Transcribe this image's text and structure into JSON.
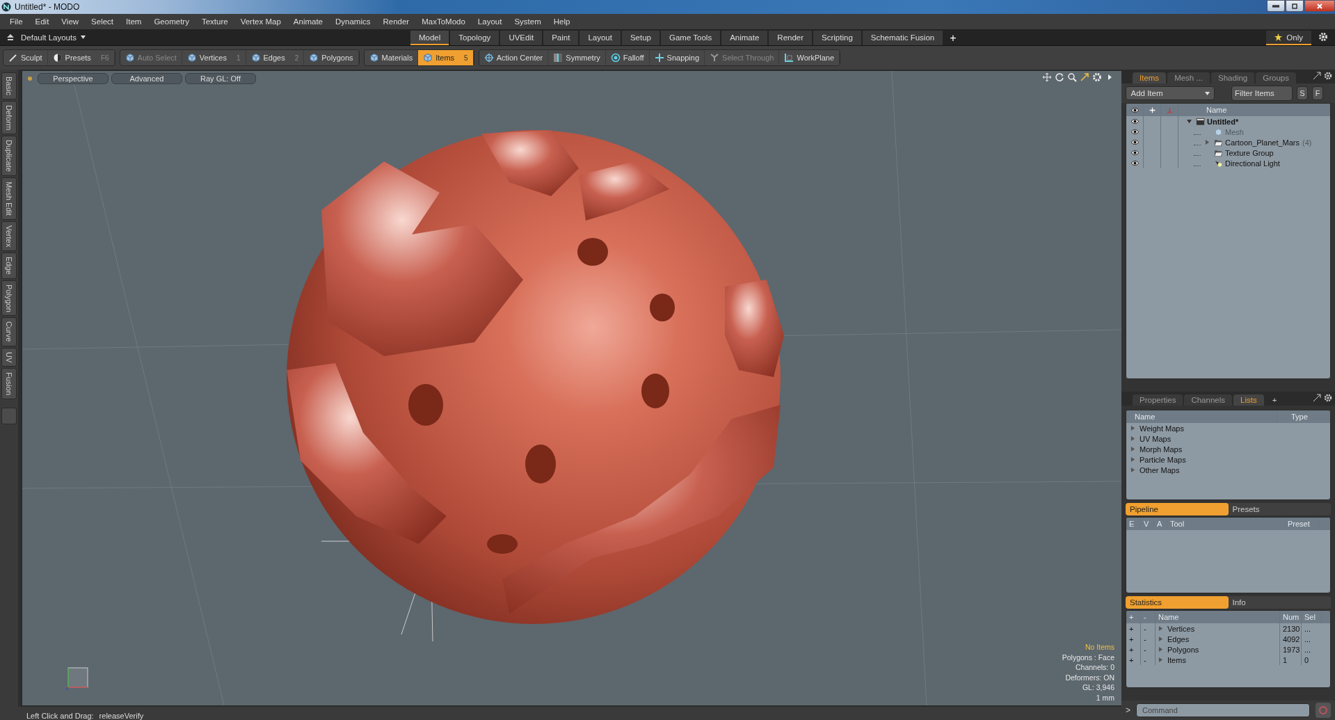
{
  "title_bar": {
    "title": "Untitled* - MODO"
  },
  "menu": [
    "File",
    "Edit",
    "View",
    "Select",
    "Item",
    "Geometry",
    "Texture",
    "Vertex Map",
    "Animate",
    "Dynamics",
    "Render",
    "MaxToModo",
    "Layout",
    "System",
    "Help"
  ],
  "layout_bar": {
    "layouts_menu": "Default Layouts",
    "tabs": [
      {
        "label": "Model",
        "selected": true
      },
      {
        "label": "Topology",
        "selected": false
      },
      {
        "label": "UVEdit",
        "selected": false
      },
      {
        "label": "Paint",
        "selected": false
      },
      {
        "label": "Layout",
        "selected": false
      },
      {
        "label": "Setup",
        "selected": false
      },
      {
        "label": "Game Tools",
        "selected": false
      },
      {
        "label": "Animate",
        "selected": false
      },
      {
        "label": "Render",
        "selected": false
      },
      {
        "label": "Scripting",
        "selected": false
      },
      {
        "label": "Schematic Fusion",
        "selected": false
      }
    ],
    "add_tab": "+",
    "only": "Only"
  },
  "toolbar": {
    "groups": [
      {
        "items": [
          {
            "label": "Sculpt",
            "selected": false,
            "disabled": false
          },
          {
            "label": "Presets",
            "shortcut": "F6",
            "selected": false,
            "disabled": false
          }
        ]
      },
      {
        "items": [
          {
            "label": "Auto Select",
            "selected": false,
            "disabled": true
          },
          {
            "label": "Vertices",
            "shortcut": "1",
            "selected": false,
            "disabled": false
          },
          {
            "label": "Edges",
            "shortcut": "2",
            "selected": false,
            "disabled": false
          },
          {
            "label": "Polygons",
            "selected": false,
            "disabled": false
          }
        ]
      },
      {
        "items": [
          {
            "label": "Materials",
            "selected": false,
            "disabled": false
          },
          {
            "label": "Items",
            "shortcut": "5",
            "selected": true,
            "disabled": false
          }
        ]
      },
      {
        "items": [
          {
            "label": "Action Center",
            "selected": false,
            "disabled": false
          },
          {
            "label": "Symmetry",
            "selected": false,
            "disabled": false
          },
          {
            "label": "Falloff",
            "selected": false,
            "disabled": false
          },
          {
            "label": "Snapping",
            "selected": false,
            "disabled": false
          },
          {
            "label": "Select Through",
            "selected": false,
            "disabled": true
          },
          {
            "label": "WorkPlane",
            "selected": false,
            "disabled": false
          }
        ]
      }
    ]
  },
  "side_tabs": [
    "Basic",
    "Deform",
    "Duplicate",
    "Mesh Edit",
    "Vertex",
    "Edge",
    "Polygon",
    "Curve",
    "UV",
    "Fusion"
  ],
  "viewport": {
    "buttons": [
      "Perspective",
      "Advanced",
      "Ray GL: Off"
    ],
    "status": "No Items",
    "info": [
      "Polygons : Face",
      "Channels: 0",
      "Deformers: ON",
      "GL: 3,946",
      "1 mm"
    ]
  },
  "status_bar": {
    "hint": "Left Click and Drag:",
    "command": "releaseVerify"
  },
  "items_panel": {
    "tabs": [
      {
        "label": "Items",
        "selected": true
      },
      {
        "label": "Mesh ...",
        "selected": false
      },
      {
        "label": "Shading",
        "selected": false
      },
      {
        "label": "Groups",
        "selected": false
      }
    ],
    "add_item": "Add Item",
    "filter": {
      "placeholder": "Filter Items"
    },
    "s_button": "S",
    "f_button": "F",
    "name_column": "Name",
    "tree": [
      {
        "label": "Untitled*",
        "kind": "scene",
        "expanded": true,
        "children": [
          {
            "label": "Mesh",
            "kind": "mesh",
            "disabled": true
          },
          {
            "label": "Cartoon_Planet_Mars",
            "count": "(4)",
            "kind": "group",
            "expanded": false
          },
          {
            "label": "Texture Group",
            "kind": "group"
          },
          {
            "label": "Directional Light",
            "kind": "light"
          }
        ]
      }
    ]
  },
  "lists_panel": {
    "tabs": [
      {
        "label": "Properties",
        "selected": false
      },
      {
        "label": "Channels",
        "selected": false
      },
      {
        "label": "Lists",
        "selected": true
      }
    ],
    "add_tab": "+",
    "columns": [
      "Name",
      "Type"
    ],
    "rows": [
      {
        "name": "Weight Maps",
        "expanded": false
      },
      {
        "name": "UV Maps",
        "expanded": false
      },
      {
        "name": "Morph Maps",
        "expanded": false
      },
      {
        "name": "Particle Maps",
        "expanded": false
      },
      {
        "name": "Other Maps",
        "expanded": false
      }
    ]
  },
  "pipeline_panel": {
    "tabs": [
      {
        "label": "Pipeline",
        "selected": true
      },
      {
        "label": "Presets",
        "selected": false
      }
    ],
    "columns": [
      "E",
      "V",
      "A",
      "Tool",
      "Preset"
    ]
  },
  "statistics_panel": {
    "tabs": [
      {
        "label": "Statistics",
        "selected": true
      },
      {
        "label": "Info",
        "selected": false
      }
    ],
    "columns": [
      "+",
      "-",
      "Name",
      "Num",
      "Sel"
    ],
    "rows": [
      {
        "add": "+",
        "remove": "-",
        "name": "Vertices",
        "num": "2130",
        "sel": "...",
        "expanded": false
      },
      {
        "add": "+",
        "remove": "-",
        "name": "Edges",
        "num": "4092",
        "sel": "...",
        "expanded": false
      },
      {
        "add": "+",
        "remove": "-",
        "name": "Polygons",
        "num": "1973",
        "sel": "...",
        "expanded": false
      },
      {
        "add": "+",
        "remove": "-",
        "name": "Items",
        "num": "1",
        "sel": "0",
        "expanded": false
      }
    ]
  },
  "command_bar": {
    "prompt": ">",
    "placeholder": "Command"
  }
}
